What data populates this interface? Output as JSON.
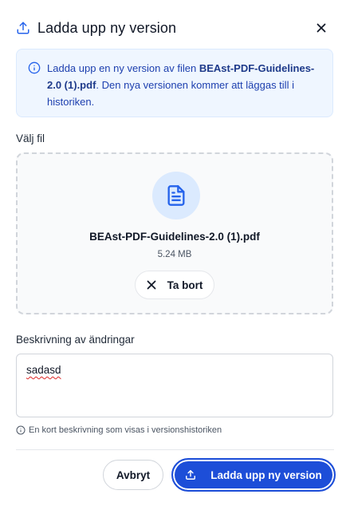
{
  "dialog": {
    "title": "Ladda upp ny version",
    "close_icon": "close-icon",
    "upload_icon": "upload-icon"
  },
  "info": {
    "icon": "info-icon",
    "text_before": "Ladda upp en ny version av filen ",
    "filename": "BEAst-PDF-Guidelines-2.0 (1).pdf",
    "text_after": ". Den nya versionen kommer att läggas till i historiken."
  },
  "file_section": {
    "label": "Välj fil",
    "file_icon": "document-icon",
    "file_name": "BEAst-PDF-Guidelines-2.0 (1).pdf",
    "file_size": "5.24 MB",
    "remove_label": "Ta bort"
  },
  "description": {
    "label": "Beskrivning av ändringar",
    "value": "sadasd",
    "hint": "En kort beskrivning som visas i versionshistoriken"
  },
  "footer": {
    "cancel_label": "Avbryt",
    "submit_label": "Ladda upp ny version"
  },
  "colors": {
    "accent": "#1d4ed8",
    "info_bg": "#eff6ff",
    "info_text": "#1e40af"
  }
}
